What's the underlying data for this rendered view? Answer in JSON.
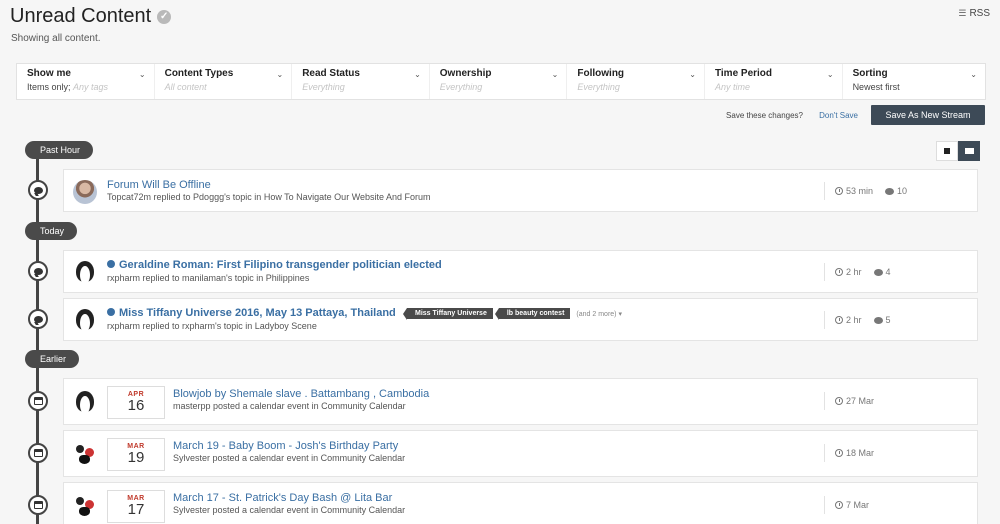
{
  "header": {
    "title": "Unread Content",
    "subtitle": "Showing all content.",
    "rss_label": "RSS"
  },
  "filters": [
    {
      "label": "Show me",
      "value": "Items only;",
      "extra": "Any tags"
    },
    {
      "label": "Content Types",
      "value": "All content"
    },
    {
      "label": "Read Status",
      "value": "Everything"
    },
    {
      "label": "Ownership",
      "value": "Everything"
    },
    {
      "label": "Following",
      "value": "Everything"
    },
    {
      "label": "Time Period",
      "value": "Any time"
    },
    {
      "label": "Sorting",
      "value": "Newest first"
    }
  ],
  "actions": {
    "save_changes_text": "Save these changes?",
    "dont_save_label": "Don't Save",
    "save_stream_label": "Save As New Stream"
  },
  "groups": {
    "past_hour": "Past Hour",
    "today": "Today",
    "earlier": "Earlier"
  },
  "items": [
    {
      "title": "Forum Will Be Offline",
      "meta": "Topcat72m replied to Pdoggg's topic in How To Navigate Our Website And Forum",
      "time": "53 min",
      "replies": "10",
      "icon": "comment-icon"
    },
    {
      "title": "Geraldine Roman: First Filipino transgender politician elected",
      "meta": "rxpharm replied to manilaman's topic in Philippines",
      "time": "2 hr",
      "replies": "4",
      "icon": "comment-icon"
    },
    {
      "title": "Miss Tiffany Universe 2016, May 13 Pattaya, Thailand",
      "meta": "rxpharm replied to rxpharm's topic in Ladyboy Scene",
      "time": "2 hr",
      "replies": "5",
      "icon": "comment-icon",
      "tags": [
        "Miss Tiffany Universe",
        "lb beauty contest"
      ],
      "more_tags": "(and 2 more) ▾"
    },
    {
      "title": "Blowjob by Shemale slave . Battambang , Cambodia",
      "meta": "masterpp posted a calendar event in Community Calendar",
      "time": "27 Mar",
      "month": "APR",
      "day": "16",
      "icon": "calendar-icon"
    },
    {
      "title": "March 19 - Baby Boom - Josh's Birthday Party",
      "meta": "Sylvester posted a calendar event in Community Calendar",
      "time": "18 Mar",
      "month": "MAR",
      "day": "19",
      "icon": "calendar-icon"
    },
    {
      "title": "March 17 - St. Patrick's Day Bash @ Lita Bar",
      "meta": "Sylvester posted a calendar event in Community Calendar",
      "time": "7 Mar",
      "month": "MAR",
      "day": "17",
      "icon": "calendar-icon"
    }
  ],
  "colors": {
    "link": "#3a6fa3",
    "dark": "#3d4a57",
    "timeline": "#444444"
  }
}
